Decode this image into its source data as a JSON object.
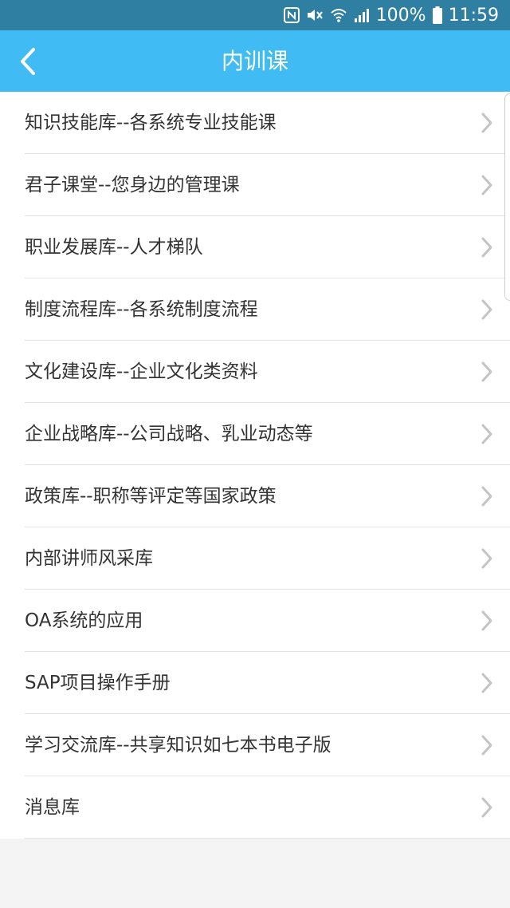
{
  "status_bar": {
    "battery": "100%",
    "time": "11:59",
    "icons": [
      "nfc-icon",
      "mute-icon",
      "wifi-icon",
      "signal-icon",
      "battery-icon"
    ]
  },
  "header": {
    "title": "内训课",
    "back_icon": "back-arrow-icon",
    "background_color": "#40bbf4"
  },
  "list": {
    "items": [
      {
        "label": "知识技能库--各系统专业技能课"
      },
      {
        "label": "君子课堂--您身边的管理课"
      },
      {
        "label": "职业发展库--人才梯队"
      },
      {
        "label": "制度流程库--各系统制度流程"
      },
      {
        "label": "文化建设库--企业文化类资料"
      },
      {
        "label": "企业战略库--公司战略、乳业动态等"
      },
      {
        "label": "政策库--职称等评定等国家政策"
      },
      {
        "label": "内部讲师风采库"
      },
      {
        "label": "OA系统的应用"
      },
      {
        "label": "SAP项目操作手册"
      },
      {
        "label": "学习交流库--共享知识如七本书电子版"
      },
      {
        "label": "消息库"
      }
    ],
    "chevron_icon": "chevron-right-icon"
  }
}
